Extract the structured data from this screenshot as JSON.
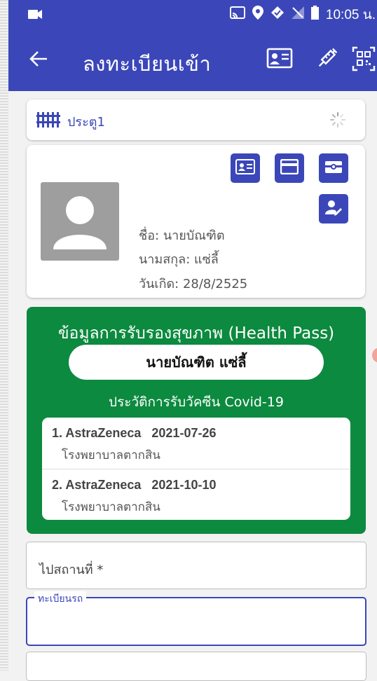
{
  "status_bar": {
    "time": "10:05 น.",
    "icons": [
      "video-icon",
      "cast-icon",
      "location-icon",
      "vpn-icon",
      "no-sim-icon",
      "battery-icon"
    ]
  },
  "app_bar": {
    "title": "ลงทะเบียนเข้า",
    "actions": [
      "id-card-icon",
      "vaccine-icon",
      "qr-code-icon"
    ]
  },
  "gate": {
    "label": "ประตู1"
  },
  "person": {
    "first_name": "ชื่อ: นายบัณฑิต",
    "last_name": "นามสกุล: แซ่ลี้",
    "birth_date": "วันเกิด: 28/8/2525",
    "buttons": [
      "read-id-card",
      "read-card",
      "camera",
      "edit-person"
    ]
  },
  "health_pass": {
    "title": "ข้อมูลการรับรองสุขภาพ (Health Pass)",
    "name": "นายบัณฑิต แซ่ลี้",
    "vaccine_history_title": "ประวัติการรับวัคซีน Covid-19",
    "doses": [
      {
        "label": "1. AstraZeneca   2021-07-26",
        "place": "โรงพยาบาลตากสิน"
      },
      {
        "label": "2. AstraZeneca   2021-10-10",
        "place": "โรงพยาบาลตากสิน"
      }
    ]
  },
  "form": {
    "destination_placeholder": "ไปสถานที่ *",
    "plate_label": "ทะเบียนรถ",
    "plate_value": ""
  },
  "colors": {
    "primary": "#3b47b8",
    "health_green": "#0c8a3f",
    "avatar_gray": "#9e9e9e"
  }
}
